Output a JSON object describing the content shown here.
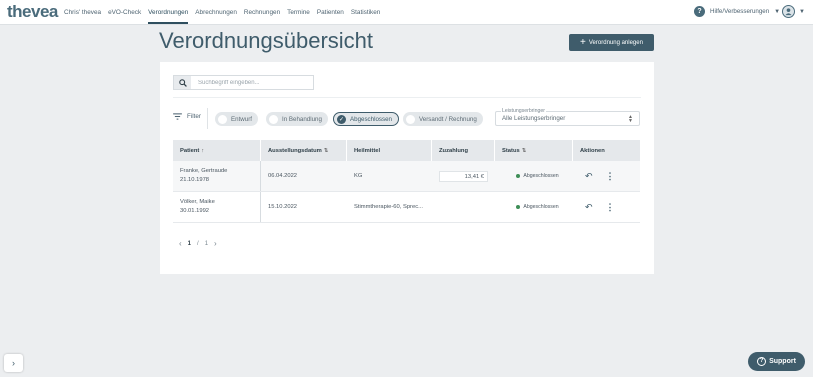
{
  "app": {
    "logo": "thevea"
  },
  "nav": {
    "items": [
      "Chris' thevea",
      "eVO-Check",
      "Verordnungen",
      "Abrechnungen",
      "Rechnungen",
      "Termine",
      "Patienten",
      "Statistiken"
    ],
    "active": "Verordnungen"
  },
  "header": {
    "help_icon": "?",
    "help_label": "Hilfe/Verbesserungen"
  },
  "page": {
    "title": "Verordnungsübersicht",
    "create_button": "Verordnung anlegen"
  },
  "search": {
    "placeholder": "Suchbegriff eingeben...",
    "value": ""
  },
  "filter": {
    "label": "Filter",
    "chips": [
      {
        "label": "Entwurf",
        "selected": false
      },
      {
        "label": "In Behandlung",
        "selected": false
      },
      {
        "label": "Abgeschlossen",
        "selected": true
      },
      {
        "label": "Versandt / Rechnung",
        "selected": false
      }
    ]
  },
  "provider": {
    "label": "Leistungserbringer",
    "value": "Alle Leistungserbringer"
  },
  "table": {
    "headers": [
      "Patient",
      "Ausstellungsdatum",
      "Heilmittel",
      "Zuzahlung",
      "Status",
      "Aktionen"
    ],
    "rows": [
      {
        "name": "Franke, Gertraude",
        "dob": "21.10.1978",
        "date": "06.04.2022",
        "remedy": "KG",
        "copay": "13,41 €",
        "status": "Abgeschlossen"
      },
      {
        "name": "Völker, Maike",
        "dob": "30.01.1992",
        "date": "15.10.2022",
        "remedy": "Stimmtherapie-60, Sprec...",
        "copay": "",
        "status": "Abgeschlossen"
      }
    ]
  },
  "pagination": {
    "current": "1",
    "separator": "/",
    "total": "1"
  },
  "support": {
    "label": "Support"
  },
  "colors": {
    "primary": "#3f5c6b",
    "status_ok": "#3e8e57",
    "background": "#eceef0"
  }
}
